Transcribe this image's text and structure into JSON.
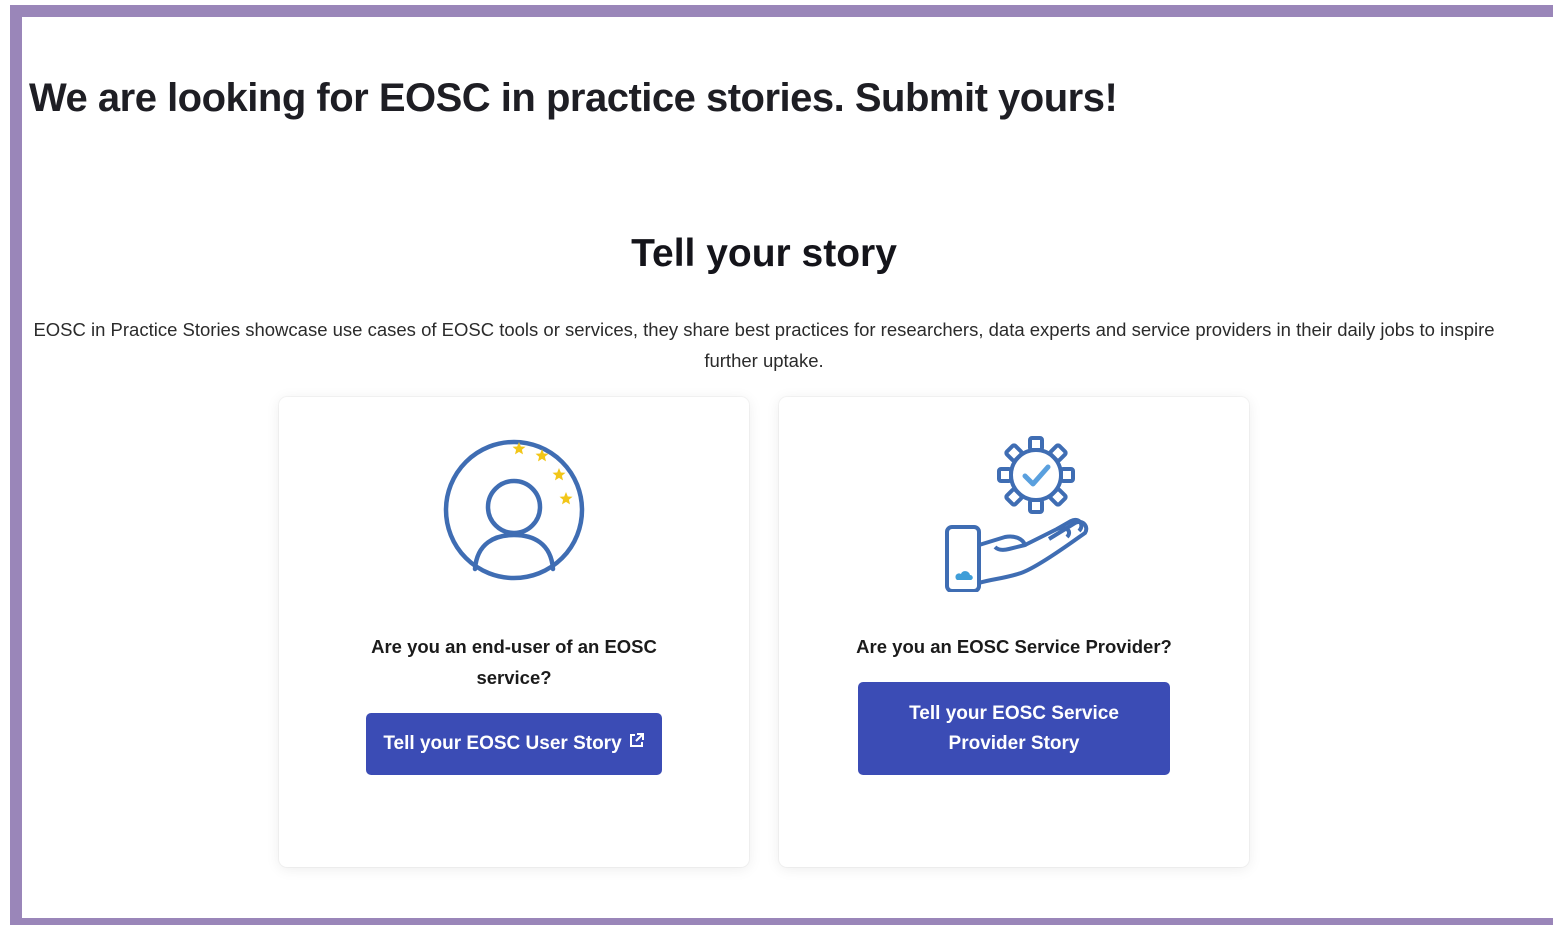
{
  "page": {
    "headline": "We are looking for EOSC in practice stories. Submit yours!",
    "section_title": "Tell your story",
    "intro": "EOSC in Practice Stories showcase use cases of EOSC tools or services, they share best practices for researchers, data experts and service providers in their daily jobs to inspire further uptake."
  },
  "cards": [
    {
      "icon": "user-with-stars-icon",
      "question": "Are you an end-user of an EOSC service?",
      "button_label": "Tell your EOSC User Story",
      "button_icon": "external-link-icon"
    },
    {
      "icon": "hand-gear-check-icon",
      "question": "Are you an EOSC Service Provider?",
      "button_label": "Tell your EOSC Service Provider Story"
    }
  ],
  "colors": {
    "frame": "#9a86b9",
    "button": "#3b4cb5",
    "icon_blue": "#3f6db3",
    "star_yellow": "#f2c618"
  }
}
